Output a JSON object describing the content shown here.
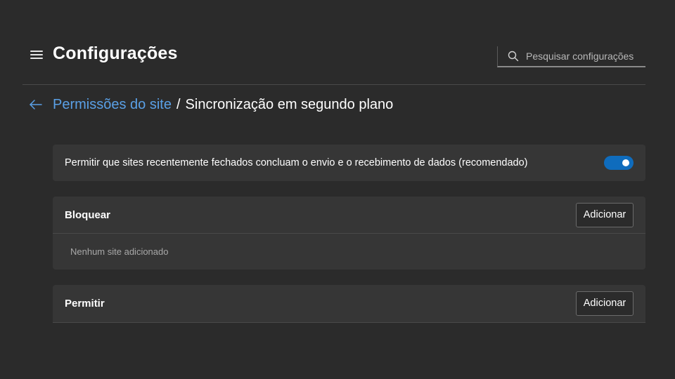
{
  "header": {
    "title": "Configurações",
    "search": {
      "placeholder": "Pesquisar configurações",
      "value": ""
    }
  },
  "breadcrumb": {
    "parent": "Permissões do site",
    "separator": "/",
    "current": "Sincronização em segundo plano"
  },
  "toggle_card": {
    "label": "Permitir que sites recentemente fechados concluam o envio e o recebimento de dados (recomendado)",
    "enabled": true
  },
  "block_card": {
    "title": "Bloquear",
    "add_label": "Adicionar",
    "empty_text": "Nenhum site adicionado"
  },
  "allow_card": {
    "title": "Permitir",
    "add_label": "Adicionar"
  },
  "colors": {
    "background": "#2b2b2b",
    "card": "#363636",
    "accent_link": "#5aa0e6",
    "toggle_on": "#0f6cbd"
  }
}
